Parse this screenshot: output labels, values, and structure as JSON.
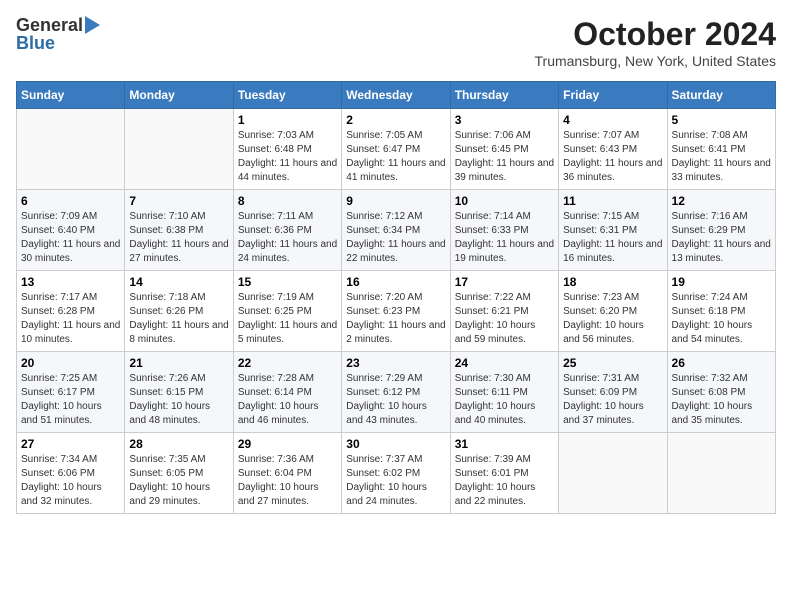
{
  "header": {
    "logo_general": "General",
    "logo_blue": "Blue",
    "month_year": "October 2024",
    "location": "Trumansburg, New York, United States"
  },
  "days_of_week": [
    "Sunday",
    "Monday",
    "Tuesday",
    "Wednesday",
    "Thursday",
    "Friday",
    "Saturday"
  ],
  "weeks": [
    [
      {
        "day": "",
        "info": ""
      },
      {
        "day": "",
        "info": ""
      },
      {
        "day": "1",
        "info": "Sunrise: 7:03 AM\nSunset: 6:48 PM\nDaylight: 11 hours and 44 minutes."
      },
      {
        "day": "2",
        "info": "Sunrise: 7:05 AM\nSunset: 6:47 PM\nDaylight: 11 hours and 41 minutes."
      },
      {
        "day": "3",
        "info": "Sunrise: 7:06 AM\nSunset: 6:45 PM\nDaylight: 11 hours and 39 minutes."
      },
      {
        "day": "4",
        "info": "Sunrise: 7:07 AM\nSunset: 6:43 PM\nDaylight: 11 hours and 36 minutes."
      },
      {
        "day": "5",
        "info": "Sunrise: 7:08 AM\nSunset: 6:41 PM\nDaylight: 11 hours and 33 minutes."
      }
    ],
    [
      {
        "day": "6",
        "info": "Sunrise: 7:09 AM\nSunset: 6:40 PM\nDaylight: 11 hours and 30 minutes."
      },
      {
        "day": "7",
        "info": "Sunrise: 7:10 AM\nSunset: 6:38 PM\nDaylight: 11 hours and 27 minutes."
      },
      {
        "day": "8",
        "info": "Sunrise: 7:11 AM\nSunset: 6:36 PM\nDaylight: 11 hours and 24 minutes."
      },
      {
        "day": "9",
        "info": "Sunrise: 7:12 AM\nSunset: 6:34 PM\nDaylight: 11 hours and 22 minutes."
      },
      {
        "day": "10",
        "info": "Sunrise: 7:14 AM\nSunset: 6:33 PM\nDaylight: 11 hours and 19 minutes."
      },
      {
        "day": "11",
        "info": "Sunrise: 7:15 AM\nSunset: 6:31 PM\nDaylight: 11 hours and 16 minutes."
      },
      {
        "day": "12",
        "info": "Sunrise: 7:16 AM\nSunset: 6:29 PM\nDaylight: 11 hours and 13 minutes."
      }
    ],
    [
      {
        "day": "13",
        "info": "Sunrise: 7:17 AM\nSunset: 6:28 PM\nDaylight: 11 hours and 10 minutes."
      },
      {
        "day": "14",
        "info": "Sunrise: 7:18 AM\nSunset: 6:26 PM\nDaylight: 11 hours and 8 minutes."
      },
      {
        "day": "15",
        "info": "Sunrise: 7:19 AM\nSunset: 6:25 PM\nDaylight: 11 hours and 5 minutes."
      },
      {
        "day": "16",
        "info": "Sunrise: 7:20 AM\nSunset: 6:23 PM\nDaylight: 11 hours and 2 minutes."
      },
      {
        "day": "17",
        "info": "Sunrise: 7:22 AM\nSunset: 6:21 PM\nDaylight: 10 hours and 59 minutes."
      },
      {
        "day": "18",
        "info": "Sunrise: 7:23 AM\nSunset: 6:20 PM\nDaylight: 10 hours and 56 minutes."
      },
      {
        "day": "19",
        "info": "Sunrise: 7:24 AM\nSunset: 6:18 PM\nDaylight: 10 hours and 54 minutes."
      }
    ],
    [
      {
        "day": "20",
        "info": "Sunrise: 7:25 AM\nSunset: 6:17 PM\nDaylight: 10 hours and 51 minutes."
      },
      {
        "day": "21",
        "info": "Sunrise: 7:26 AM\nSunset: 6:15 PM\nDaylight: 10 hours and 48 minutes."
      },
      {
        "day": "22",
        "info": "Sunrise: 7:28 AM\nSunset: 6:14 PM\nDaylight: 10 hours and 46 minutes."
      },
      {
        "day": "23",
        "info": "Sunrise: 7:29 AM\nSunset: 6:12 PM\nDaylight: 10 hours and 43 minutes."
      },
      {
        "day": "24",
        "info": "Sunrise: 7:30 AM\nSunset: 6:11 PM\nDaylight: 10 hours and 40 minutes."
      },
      {
        "day": "25",
        "info": "Sunrise: 7:31 AM\nSunset: 6:09 PM\nDaylight: 10 hours and 37 minutes."
      },
      {
        "day": "26",
        "info": "Sunrise: 7:32 AM\nSunset: 6:08 PM\nDaylight: 10 hours and 35 minutes."
      }
    ],
    [
      {
        "day": "27",
        "info": "Sunrise: 7:34 AM\nSunset: 6:06 PM\nDaylight: 10 hours and 32 minutes."
      },
      {
        "day": "28",
        "info": "Sunrise: 7:35 AM\nSunset: 6:05 PM\nDaylight: 10 hours and 29 minutes."
      },
      {
        "day": "29",
        "info": "Sunrise: 7:36 AM\nSunset: 6:04 PM\nDaylight: 10 hours and 27 minutes."
      },
      {
        "day": "30",
        "info": "Sunrise: 7:37 AM\nSunset: 6:02 PM\nDaylight: 10 hours and 24 minutes."
      },
      {
        "day": "31",
        "info": "Sunrise: 7:39 AM\nSunset: 6:01 PM\nDaylight: 10 hours and 22 minutes."
      },
      {
        "day": "",
        "info": ""
      },
      {
        "day": "",
        "info": ""
      }
    ]
  ]
}
